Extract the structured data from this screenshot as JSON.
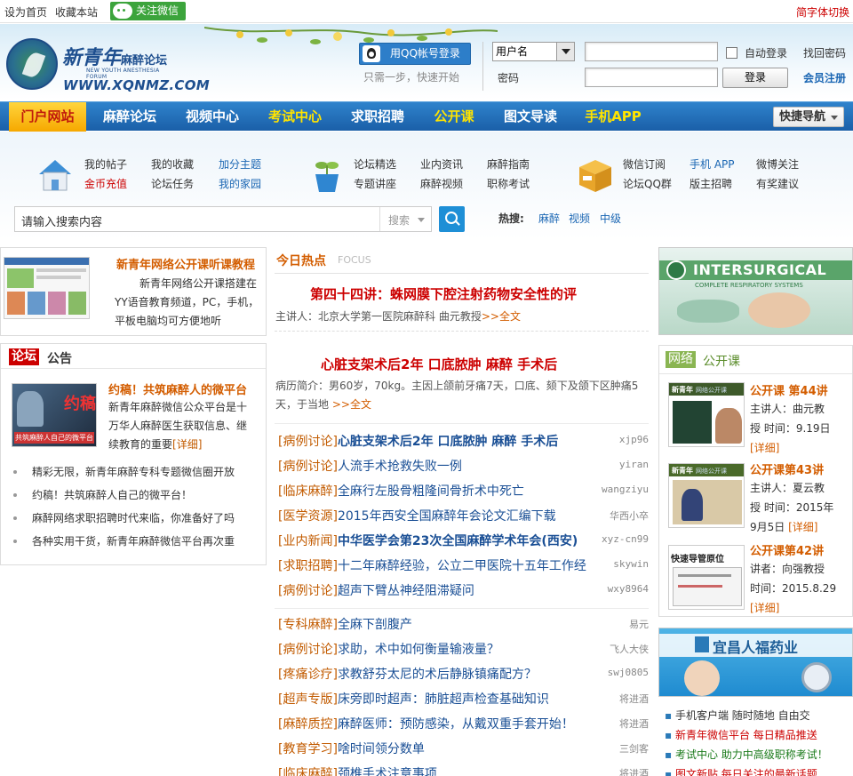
{
  "topbar": {
    "home": "设为首页",
    "fav": "收藏本站",
    "wechat": "关注微信",
    "switch": "简字体切换"
  },
  "logo": {
    "name": "新青年",
    "suffix": "麻醉论坛",
    "en": "NEW YOUTH ANESTHESIA FORUM",
    "url": "WWW.XQNMZ.COM"
  },
  "login": {
    "qq": "用QQ帐号登录",
    "qq_sub": "只需一步，快速开始",
    "user_select": "用户名",
    "pw_label": "密码",
    "auto": "自动登录",
    "findpw": "找回密码",
    "login_btn": "登录",
    "register": "会员注册"
  },
  "nav": {
    "items": [
      "门户网站",
      "麻醉论坛",
      "视频中心",
      "考试中心",
      "求职招聘",
      "公开课",
      "图文导读",
      "手机APP"
    ],
    "quick": "快捷导航"
  },
  "panel": {
    "g1": [
      "我的帖子",
      "我的收藏",
      "加分主题",
      "金币充值",
      "论坛任务",
      "我的家园"
    ],
    "g2": [
      "论坛精选",
      "业内资讯",
      "麻醉指南",
      "专题讲座",
      "麻醉视频",
      "职称考试"
    ],
    "g3": [
      "微信订阅",
      "手机 APP",
      "微博关注",
      "论坛QQ群",
      "版主招聘",
      "有奖建议"
    ]
  },
  "search": {
    "placeholder": "请输入搜索内容",
    "type": "搜索",
    "hot_label": "热搜:",
    "hot": [
      "麻醉",
      "视频",
      "中级"
    ]
  },
  "left": {
    "course_title": "新青年网络公开课听课教程",
    "course_desc": "新青年网络公开课搭建在YY语音教育频道，PC，手机，平板电脑均可方便地听",
    "tab1": "论坛",
    "tab2": "公告",
    "notice_title": "约稿！共筑麻醉人的微平台",
    "notice_desc": "新青年麻醉微信公众平台是十万华人麻醉医生获取信息、继续教育的重要",
    "detail": "[详细]",
    "notice_img_big": "约稿",
    "notice_img_txt": "共筑麻醉人自己的微平台",
    "items": [
      "精彩无限，新青年麻醉专科专题微信圈开放",
      "约稿！共筑麻醉人自己的微平台！",
      "麻醉网络求职招聘时代来临，你准备好了吗",
      "各种实用干货，新青年麻醉微信平台再次重"
    ]
  },
  "center": {
    "head": "今日热点",
    "head_en": "FOCUS",
    "h1": "第四十四讲：蛛网膜下腔注射药物安全性的评",
    "h1_sub": "主讲人：北京大学第一医院麻醉科  曲元教授",
    "more": ">>全文",
    "h2": "心脏支架术后2年  口底脓肿  麻醉  手术后",
    "h2_sub": "病历简介：男60岁，70kg。主因上颌前牙痛7天，口底、颏下及颌下区肿痛5天，于当地",
    "list1": [
      {
        "cat": "[病例讨论]",
        "title": "心脏支架术后2年  口底脓肿  麻醉  手术后",
        "au": "xjp96",
        "bold": true
      },
      {
        "cat": "[病例讨论]",
        "title": "人流手术抢救失败一例",
        "au": "yiran",
        "bold": false
      },
      {
        "cat": "[临床麻醉]",
        "title": "全麻行左股骨粗隆间骨折术中死亡",
        "au": "wangziyu",
        "bold": false
      },
      {
        "cat": "[医学资源]",
        "title": "2015年西安全国麻醉年会论文汇编下载",
        "au": "华西小卒",
        "bold": false
      },
      {
        "cat": "[业内新闻]",
        "title": "中华医学会第23次全国麻醉学术年会(西安)",
        "au": "xyz-cn99",
        "bold": true
      },
      {
        "cat": "[求职招聘]",
        "title": "十二年麻醉经验，公立二甲医院十五年工作经",
        "au": "skywin",
        "bold": false
      },
      {
        "cat": "[病例讨论]",
        "title": "超声下臂丛神经阻滞疑问",
        "au": "wxy8964",
        "bold": false
      }
    ],
    "list2": [
      {
        "cat": "[专科麻醉]",
        "title": "全麻下剖腹产",
        "au": "易元"
      },
      {
        "cat": "[病例讨论]",
        "title": "求助，术中如何衡量输液量？",
        "au": "飞人大侠"
      },
      {
        "cat": "[疼痛诊疗]",
        "title": "求教舒芬太尼的术后静脉镇痛配方？",
        "au": "swj0805"
      },
      {
        "cat": "[超声专版]",
        "title": "床旁即时超声：肺脏超声检查基础知识",
        "au": "将进酒"
      },
      {
        "cat": "[麻醉质控]",
        "title": "麻醉医师：预防感染，从戴双重手套开始！",
        "au": "将进酒"
      },
      {
        "cat": "[教育学习]",
        "title": "啥时间领分数单",
        "au": "三剑客"
      },
      {
        "cat": "[临床麻醉]",
        "title": "颈椎手术注意事项",
        "au": "将进酒"
      }
    ]
  },
  "right": {
    "ad1": "INTERSURGICAL",
    "ad1_sub": "COMPLETE RESPIRATORY SYSTEMS",
    "tab1": "网络",
    "tab2": "公开课",
    "courses": [
      {
        "title": "公开课  第44讲",
        "l1": "主讲人：曲元教",
        "l2": "授  时间：9.19日",
        "d": "[详细]"
      },
      {
        "title": "公开课第43讲",
        "l1": "主讲人：夏云教",
        "l2": "授  时间：2015年",
        "l3": "9月5日",
        "d": "[详细]"
      },
      {
        "title": "公开课第42讲",
        "l1": "讲者：向强教授",
        "l2": "时间：2015.8.29",
        "d": "[详细]"
      }
    ],
    "thumb_brand": "新青年",
    "thumb_sub": "网络公开课",
    "thumb3": "快速导管原位",
    "ad2": "宜昌人福药业",
    "links": [
      {
        "t": "手机客户端  随时随地  自由交",
        "c": "#333"
      },
      {
        "t": "新青年微信平台  每日精品推送",
        "c": "#c00"
      },
      {
        "t": "考试中心  助力中高级职称考试！",
        "c": "#1a7a1a"
      },
      {
        "t": "图文新贴  每日关注的最新话题",
        "c": "#c00"
      }
    ]
  }
}
